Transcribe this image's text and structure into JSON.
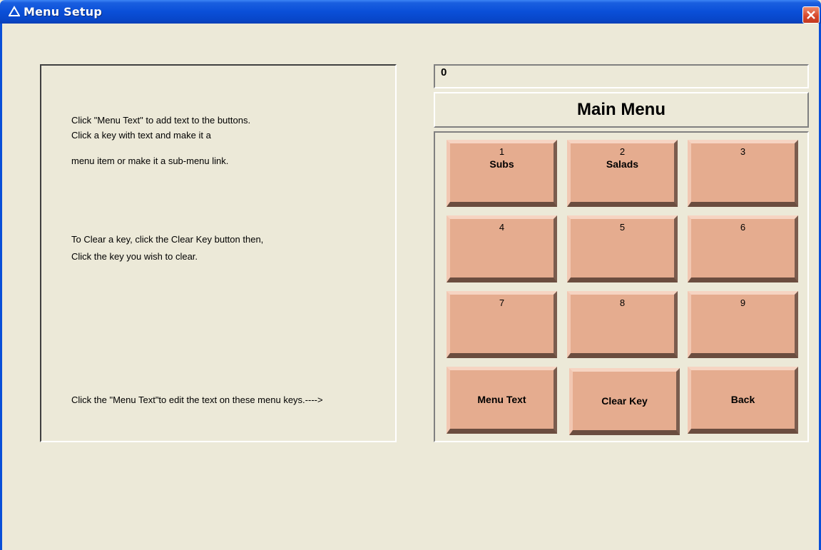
{
  "window": {
    "title": "Menu Setup",
    "close_symbol": "✕"
  },
  "instructions": {
    "line1": "Click \"Menu Text\" to add text to the buttons.",
    "line2": "Click a key with text and make it a",
    "line3": "menu item or make it a sub-menu link.",
    "line4": "To Clear a key, click the Clear Key button then,",
    "line5": "Click the key you wish to clear.",
    "line6": "Click the \"Menu Text\"to edit the text on these menu keys.---->"
  },
  "display": {
    "value": "0",
    "menu_name": "Main Menu"
  },
  "keys": [
    {
      "number": "1",
      "label": "Subs"
    },
    {
      "number": "2",
      "label": "Salads"
    },
    {
      "number": "3",
      "label": ""
    },
    {
      "number": "4",
      "label": ""
    },
    {
      "number": "5",
      "label": ""
    },
    {
      "number": "6",
      "label": ""
    },
    {
      "number": "7",
      "label": ""
    },
    {
      "number": "8",
      "label": ""
    },
    {
      "number": "9",
      "label": ""
    }
  ],
  "actions": {
    "menu_text": "Menu Text",
    "clear_key": "Clear Key",
    "back": "Back"
  },
  "colors": {
    "key_face": "#e5ac8f",
    "window_bg": "#ece9d8",
    "titlebar": "#0a4fd8"
  },
  "icons": {
    "app": "delta-triangle-icon",
    "close": "close-icon"
  }
}
